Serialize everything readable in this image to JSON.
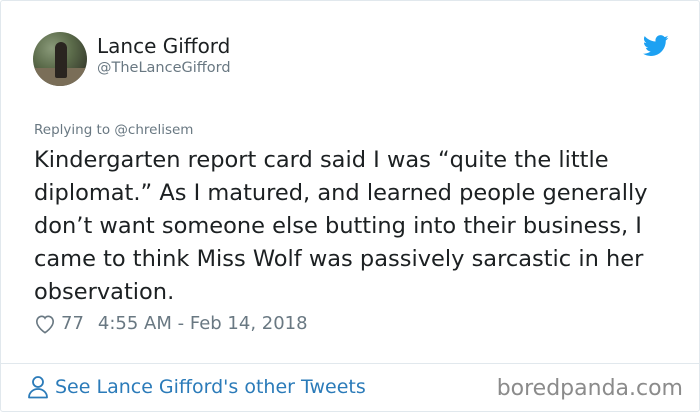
{
  "author": {
    "display_name": "Lance Gifford",
    "handle": "@TheLanceGifford"
  },
  "tweet": {
    "reply_to": "Replying to @chrelisem",
    "text": "Kindergarten report card said I was “quite the little diplomat.” As I matured, and learned people generally don’t want someone else butting into their business, I came to think Miss Wolf was passively sarcastic in her observation.",
    "likes": "77",
    "timestamp": "4:55 AM - Feb 14, 2018"
  },
  "footer": {
    "link_label": "See Lance Gifford's other Tweets",
    "watermark": "boredpanda.com"
  },
  "icons": {
    "brand": "twitter-bird-icon",
    "like": "heart-icon",
    "profile": "person-icon"
  },
  "colors": {
    "twitter_blue": "#1da1f2",
    "link_blue": "#2b7bb9",
    "secondary_text": "#697882",
    "primary_text": "#1c2022"
  }
}
